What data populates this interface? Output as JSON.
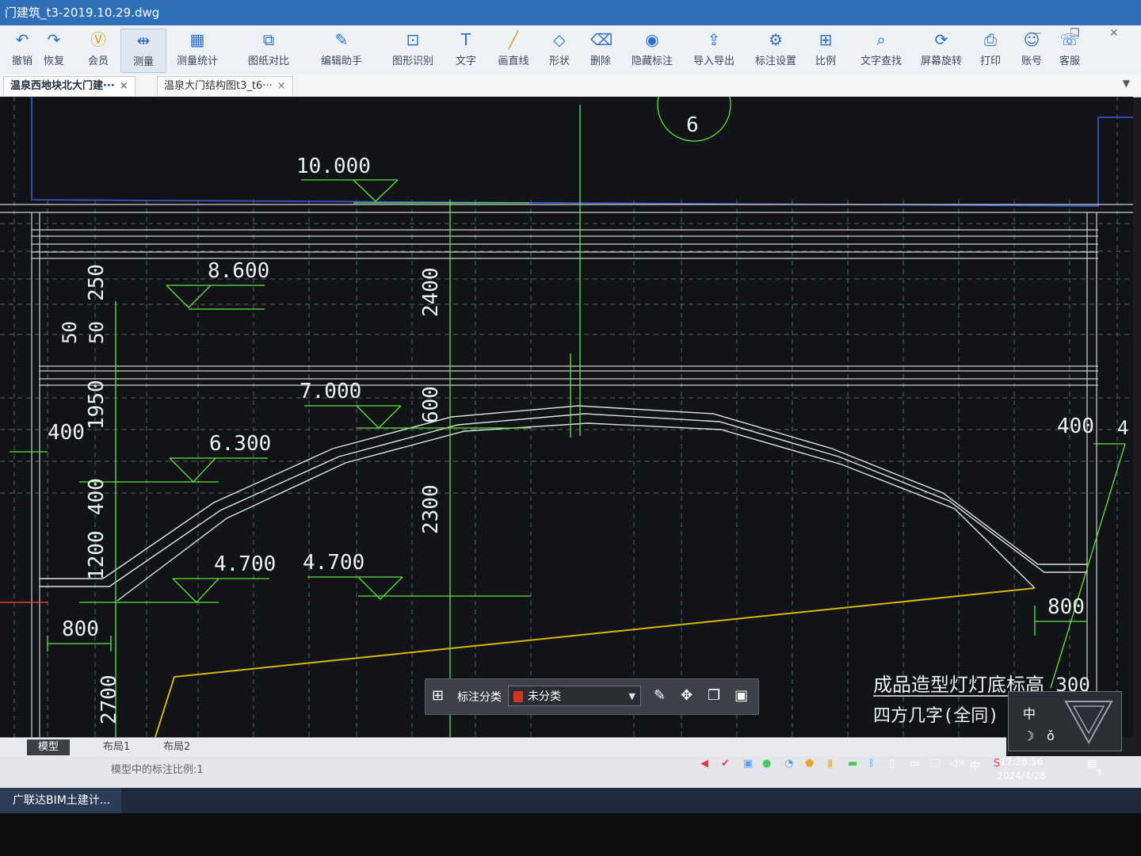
{
  "window": {
    "title": "门建筑_t3-2019.10.29.dwg"
  },
  "toolbar": {
    "items": [
      {
        "label": "撤销",
        "icon": "undo-icon"
      },
      {
        "label": "恢复",
        "icon": "redo-icon"
      },
      {
        "label": "会员",
        "icon": "vip-icon"
      },
      {
        "label": "测量",
        "icon": "measure-icon"
      },
      {
        "label": "测量统计",
        "icon": "measure-stats-icon"
      },
      {
        "label": "图纸对比",
        "icon": "compare-icon"
      },
      {
        "label": "编辑助手",
        "icon": "edit-helper-icon"
      },
      {
        "label": "图形识别",
        "icon": "shape-recognition-icon"
      },
      {
        "label": "文字",
        "icon": "text-icon"
      },
      {
        "label": "画直线",
        "icon": "line-icon"
      },
      {
        "label": "形状",
        "icon": "shape-icon"
      },
      {
        "label": "删除",
        "icon": "eraser-icon"
      },
      {
        "label": "隐藏标注",
        "icon": "hide-annotation-icon"
      },
      {
        "label": "导入导出",
        "icon": "import-export-icon"
      },
      {
        "label": "标注设置",
        "icon": "annotation-settings-icon"
      },
      {
        "label": "比例",
        "icon": "scale-icon"
      },
      {
        "label": "文字查找",
        "icon": "text-search-icon"
      },
      {
        "label": "屏幕旋转",
        "icon": "rotate-screen-icon"
      },
      {
        "label": "打印",
        "icon": "print-icon"
      },
      {
        "label": "账号",
        "icon": "account-icon"
      },
      {
        "label": "客服",
        "icon": "support-icon"
      }
    ]
  },
  "tabs": [
    {
      "label": "温泉西地块北大门建···"
    },
    {
      "label": "温泉大门结构图t3_t6···"
    }
  ],
  "drawing": {
    "circle_label": "6",
    "elevations": [
      "10.000",
      "8.600",
      "7.000",
      "6.300",
      "4.700",
      "4.700"
    ],
    "dimensions": [
      "2400",
      "600",
      "2300",
      "250",
      "50",
      "50",
      "1950",
      "400",
      "400",
      "1200",
      "800",
      "2700",
      "400",
      "800",
      "4"
    ],
    "note_line1": "成品造型灯灯底标高 300",
    "note_line2": "四方几字(全同)"
  },
  "layout_tabs": [
    "模型",
    "布局1",
    "布局2"
  ],
  "status": {
    "text": "模型中的标注比例:1"
  },
  "annotation_bar": {
    "label": "标注分类",
    "selected": "未分类"
  },
  "ime": {
    "mode": "中",
    "moon": "☽",
    "extra": "ǒ"
  },
  "taskbar": {
    "app": "广联达BIM土建计...",
    "time": "17:28:56",
    "date": "2024/4/28",
    "tray_lang": "中",
    "notif_count": "3"
  }
}
